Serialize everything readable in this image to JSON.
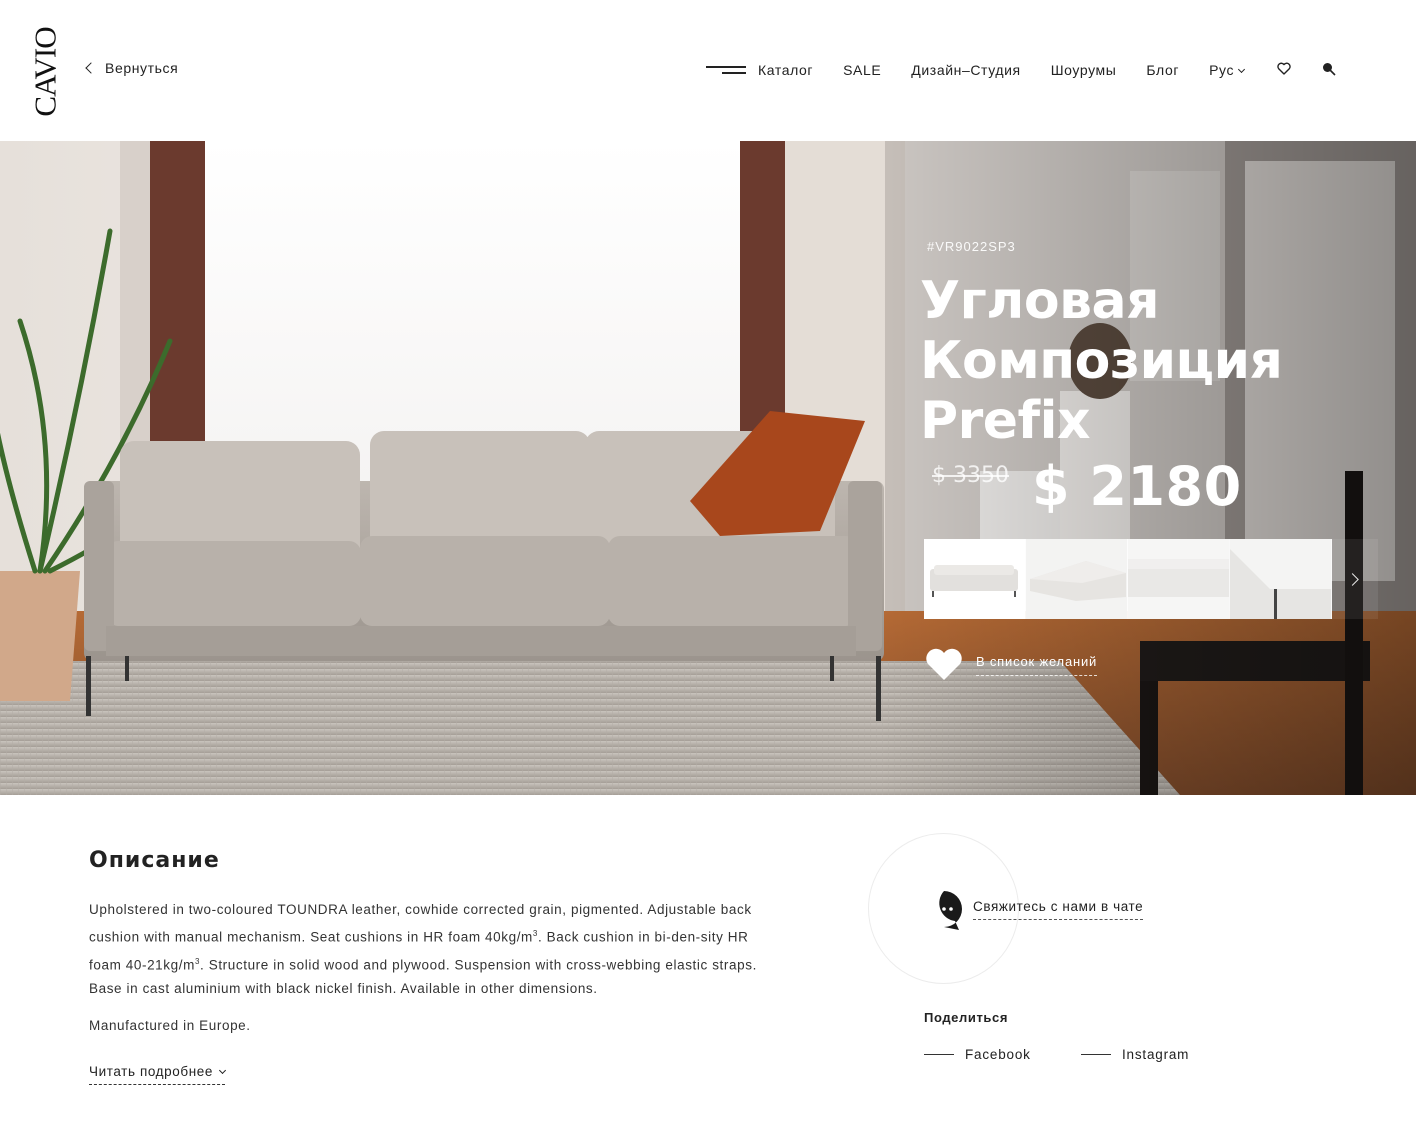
{
  "brand": {
    "logo_text": "CAVIO"
  },
  "header": {
    "back_label": "Вернуться",
    "nav": [
      {
        "label": "Каталог"
      },
      {
        "label": "SALE"
      },
      {
        "label": "Дизайн–Студия"
      },
      {
        "label": "Шоурумы"
      },
      {
        "label": "Блог"
      },
      {
        "label": "Рус"
      }
    ],
    "icons": [
      "menu-icon",
      "heart-icon",
      "search-icon"
    ]
  },
  "product": {
    "sku": "#VR9022SP3",
    "title": "Угловая Композиция Prefix",
    "old_price": "$ 3350",
    "price": "$ 2180",
    "thumbnails_count": 4,
    "wishlist_label": "В список желаний"
  },
  "description": {
    "title": "Описание",
    "text_part1": "Upholstered in two-coloured TOUNDRA leather, cowhide corrected grain, pigmented. Adjustable back cushion with manual mechanism. Seat cushions in HR foam 40kg/m",
    "sup1": "3",
    "text_part2": ". Back cushion in bi-den-sity HR foam 40-21kg/m",
    "sup2": "3",
    "text_part3": ". Structure in solid wood and plywood. Suspension with cross-webbing elastic straps. Base in cast aluminium with black nickel finish. Available in other dimensions.",
    "extra": "Manufactured in Europe.",
    "read_more": "Читать подробнее"
  },
  "chat": {
    "label": "Свяжитесь с нами в чате"
  },
  "share": {
    "title": "Поделиться",
    "facebook": "Facebook",
    "instagram": "Instagram"
  },
  "colors": {
    "text": "#222222",
    "background": "#ffffff",
    "accent_pillow": "#a8471c"
  }
}
